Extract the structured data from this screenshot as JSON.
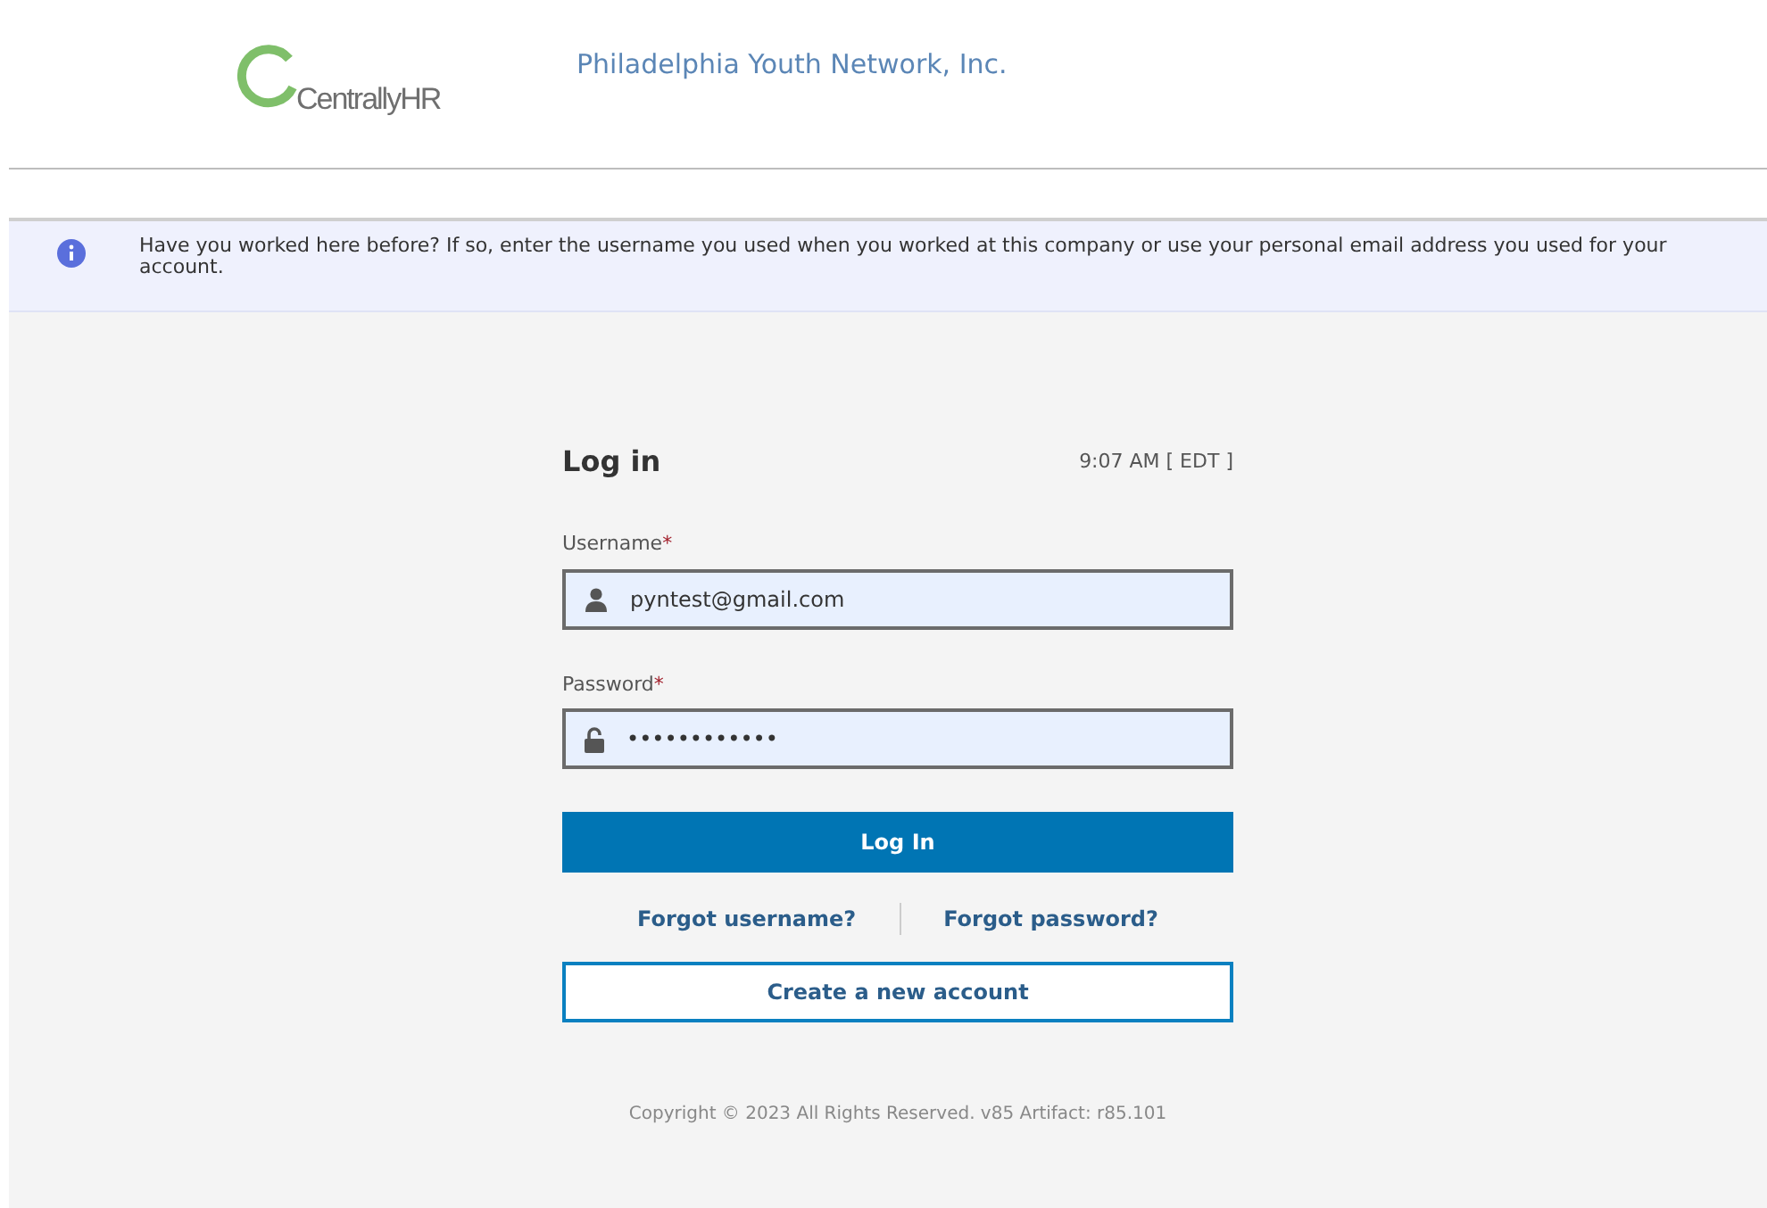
{
  "header": {
    "logo_text": "CentrallyHR",
    "company": "Philadelphia Youth Network, Inc."
  },
  "notice": {
    "text": "Have you worked here before? If so, enter the username you used when you worked at this company or use your personal email address you used for your account."
  },
  "login": {
    "title": "Log in",
    "time": "9:07 AM [ EDT ]",
    "fields": [
      {
        "kind": "user",
        "label": "Username",
        "required_mark": "*",
        "value": "pyntest@gmail.com"
      },
      {
        "kind": "lock",
        "label": "Password",
        "required_mark": "*",
        "value": "••••••••••••"
      }
    ],
    "submit": "Log In",
    "links": [
      "Forgot username?",
      "Forgot password?"
    ],
    "create_account": "Create a new account",
    "copyright": "Copyright © 2023 All Rights Reserved. v85 Artifact: r85.101"
  }
}
